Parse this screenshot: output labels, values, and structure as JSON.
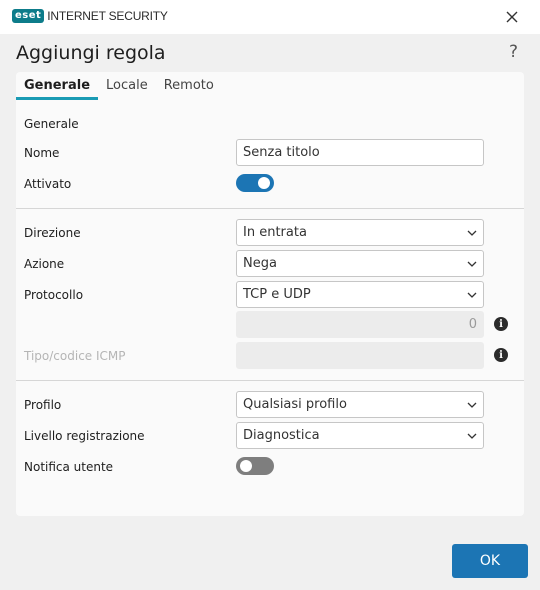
{
  "app": {
    "logo_text": "eset",
    "product_name": "INTERNET SECURITY"
  },
  "dialog": {
    "title": "Aggiungi regola",
    "help": "?"
  },
  "tabs": [
    {
      "label": "Generale",
      "active": true
    },
    {
      "label": "Locale",
      "active": false
    },
    {
      "label": "Remoto",
      "active": false
    }
  ],
  "form": {
    "section_title": "Generale",
    "name": {
      "label": "Nome",
      "value": "Senza titolo"
    },
    "enabled": {
      "label": "Attivato",
      "state": "on"
    },
    "direction": {
      "label": "Direzione",
      "value": "In entrata"
    },
    "action": {
      "label": "Azione",
      "value": "Nega"
    },
    "protocol": {
      "label": "Protocollo",
      "value": "TCP e UDP"
    },
    "protocol_number": {
      "value": "0"
    },
    "icmp": {
      "label": "Tipo/codice ICMP",
      "value": ""
    },
    "profile": {
      "label": "Profilo",
      "value": "Qualsiasi profilo"
    },
    "log_level": {
      "label": "Livello registrazione",
      "value": "Diagnostica"
    },
    "notify": {
      "label": "Notifica utente",
      "state": "off"
    }
  },
  "footer": {
    "ok_label": "OK"
  },
  "colors": {
    "accent": "#1c75b4",
    "tab_underline": "#1a9bb4",
    "logo": "#0d7c8a"
  }
}
